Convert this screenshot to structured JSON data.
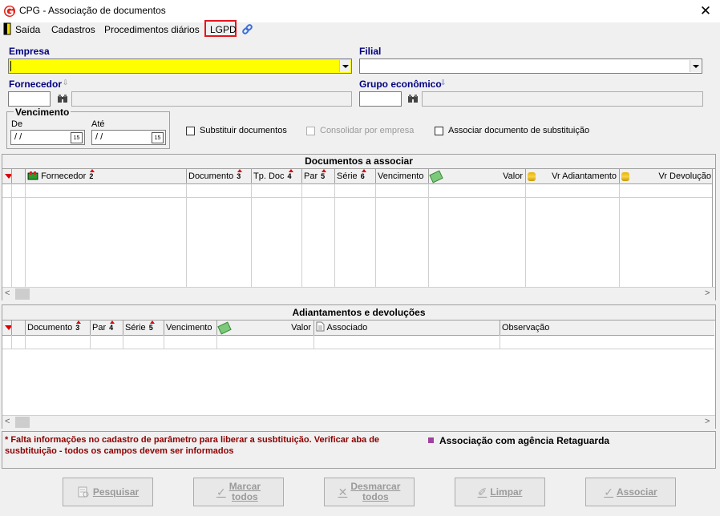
{
  "window": {
    "title": "CPG - Associação de documentos",
    "close_symbol": "✕"
  },
  "menu": {
    "items": [
      "Saída",
      "Cadastros",
      "Procedimentos diários",
      "LGPD"
    ]
  },
  "filters": {
    "empresa_label": "Empresa",
    "empresa_value": "",
    "filial_label": "Filial",
    "filial_value": "",
    "fornecedor_label": "Fornecedor",
    "grupo_label": "Grupo econômico",
    "vencimento_label": "Vencimento",
    "de_label": "De",
    "ate_label": "Até",
    "de_value": " / /",
    "ate_value": " / /",
    "calendar_day": "15"
  },
  "options": {
    "substituir": "Substituir documentos",
    "consolidar": "Consolidar por empresa",
    "associar": "Associar documento de substituição"
  },
  "grid1": {
    "title": "Documentos a associar",
    "columns": [
      "Fornecedor",
      "Documento",
      "Tp. Doc",
      "Par",
      "Série",
      "Vencimento",
      "Valor",
      "Vr Adiantamento",
      "Vr Devolução"
    ],
    "sort": [
      "2",
      "3",
      "4",
      "5",
      "6"
    ]
  },
  "grid2": {
    "title": "Adiantamentos e devoluções",
    "columns": [
      "Documento",
      "Par",
      "Série",
      "Vencimento",
      "Valor",
      "Associado",
      "Observação"
    ],
    "sort": [
      "3",
      "4",
      "5"
    ]
  },
  "notes": {
    "warning": "* Falta informações no cadastro de parâmetro para liberar a susbtituição. Verificar aba de susbtituição - todos os campos devem ser informados",
    "legend": "Associação com agência Retaguarda",
    "legend_color": "#a040a0",
    "warning_color": "#8b0000"
  },
  "buttons": {
    "pesquisar": "Pesquisar",
    "marcar_1": "Marcar",
    "marcar_2": "todos",
    "desmarcar_1": "Desmarcar",
    "desmarcar_2": "todos",
    "limpar": "Limpar",
    "associar": "Associar"
  },
  "colors": {
    "empresa_field": "#ffff00",
    "lgpd_highlight": "#e8141c",
    "label_blue": "#000080"
  }
}
